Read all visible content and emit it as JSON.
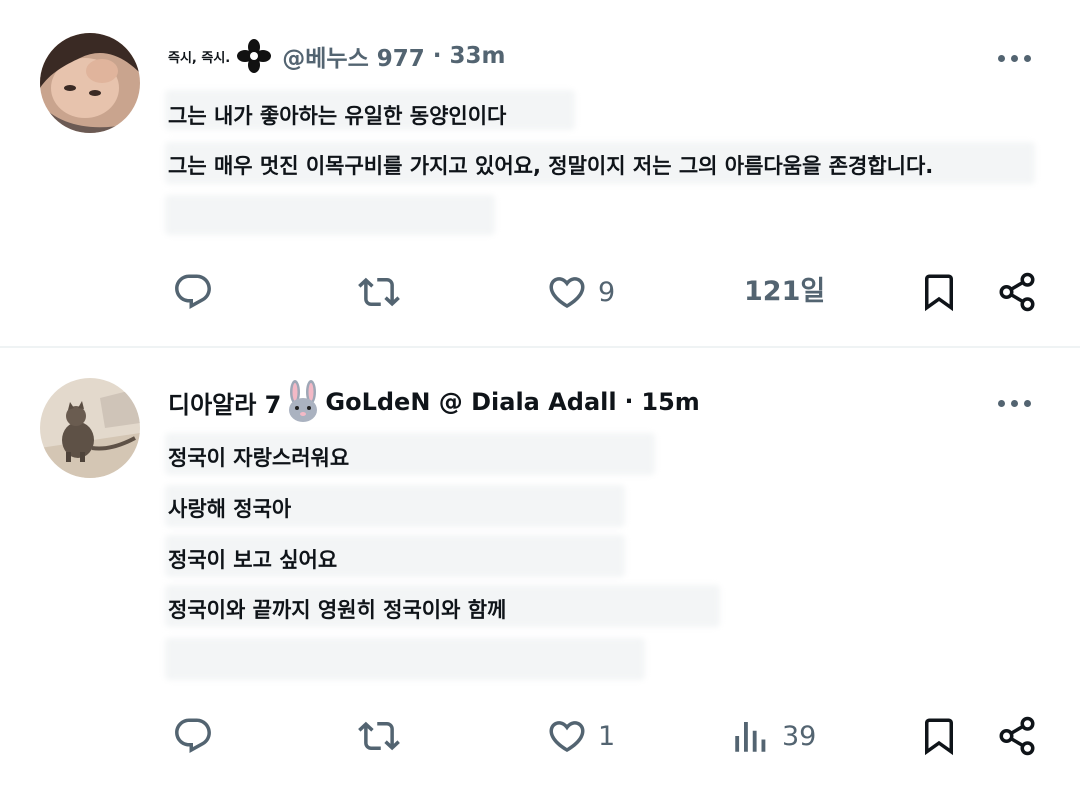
{
  "tweets": [
    {
      "author_prefix": "즉시, 즉시.",
      "handle": "@베누스 977",
      "separator": "·",
      "time": "33m",
      "lines": [
        "그는 내가 좋아하는 유일한 동양인이다",
        "그는 매우 멋진 이목구비를 가지고 있어요, 정말이지 저는 그의 아름다움을 존경합니다."
      ],
      "actions": {
        "reply_icon": "reply-icon",
        "retweet_icon": "retweet-icon",
        "like_icon": "heart-icon",
        "like_count": "9",
        "views_text": "121일",
        "bookmark_icon": "bookmark-icon",
        "share_icon": "share-icon"
      }
    },
    {
      "author_name": "디아알라 7",
      "author_suffix": "GoLdeN @ Diala Adall",
      "separator": "·",
      "time": "15m",
      "lines": [
        "정국이 자랑스러워요",
        "사랑해 정국아",
        "정국이 보고 싶어요",
        "정국이와 끝까지 영원히 정국이와 함께"
      ],
      "actions": {
        "reply_icon": "reply-icon",
        "retweet_icon": "retweet-icon",
        "like_icon": "heart-icon",
        "like_count": "1",
        "views_icon": "views-chart-icon",
        "views_count": "39",
        "bookmark_icon": "bookmark-icon",
        "share_icon": "share-icon"
      }
    }
  ],
  "colors": {
    "text": "#0f1419",
    "muted": "#536471",
    "divider": "#eff3f4"
  }
}
